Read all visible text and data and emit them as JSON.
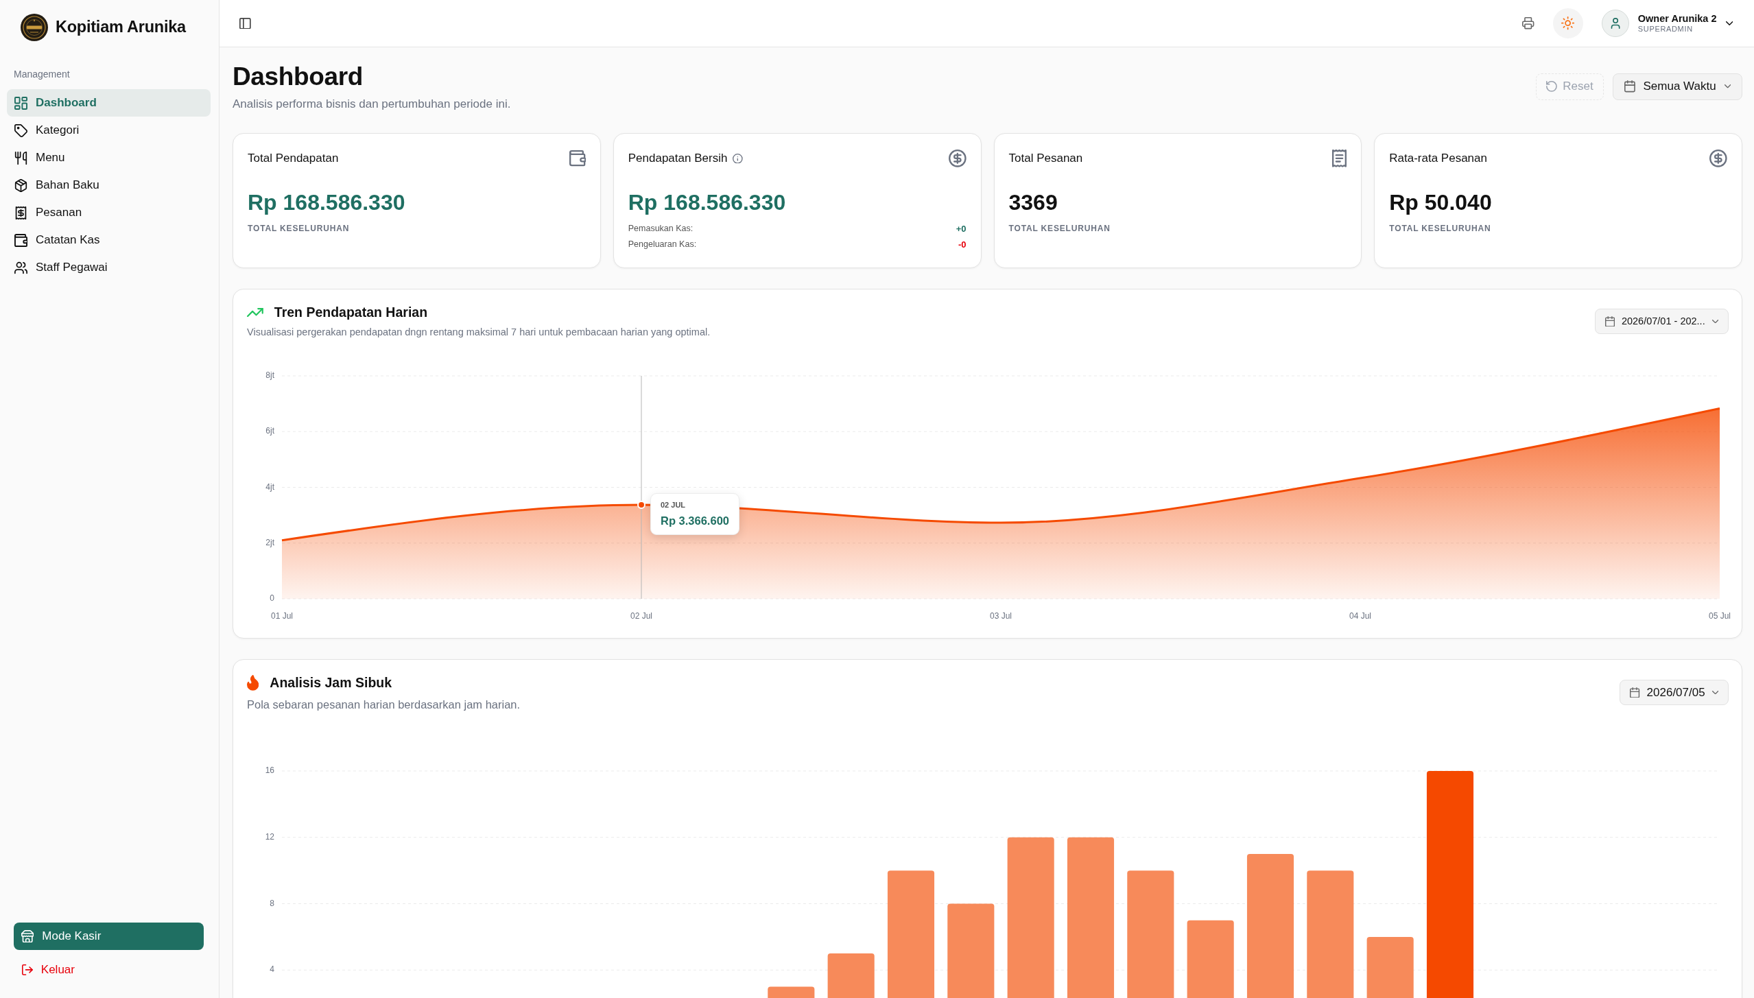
{
  "sidebar": {
    "brand": "Kopitiam Arunika",
    "section": "Management",
    "items": [
      {
        "label": "Dashboard",
        "selected": true
      },
      {
        "label": "Kategori",
        "selected": false
      },
      {
        "label": "Menu",
        "selected": false
      },
      {
        "label": "Bahan Baku",
        "selected": false
      },
      {
        "label": "Pesanan",
        "selected": false
      },
      {
        "label": "Catatan Kas",
        "selected": false
      },
      {
        "label": "Staff Pegawai",
        "selected": false
      }
    ],
    "cashier_button": "Mode Kasir",
    "logout": "Keluar"
  },
  "topbar": {
    "user": {
      "name": "Owner Arunika 2",
      "role": "SUPERADMIN"
    }
  },
  "header": {
    "title": "Dashboard",
    "subtitle": "Analisis performa bisnis dan pertumbuhan periode ini.",
    "reset_button": {
      "label": "Reset",
      "disabled": true
    },
    "period_button": "Semua Waktu"
  },
  "stats": [
    {
      "title": "Total Pendapatan",
      "has_info": false,
      "value": "Rp 168.586.330",
      "accent": true,
      "caption": "TOTAL KESELURUHAN"
    },
    {
      "title": "Pendapatan Bersih",
      "has_info": true,
      "value": "Rp 168.586.330",
      "accent": true,
      "breakdown": [
        {
          "label": "Pemasukan Kas:",
          "value": "+0",
          "color": "#1f6f62"
        },
        {
          "label": "Pengeluaran Kas:",
          "value": "-0",
          "color": "#e7000b"
        }
      ]
    },
    {
      "title": "Total Pesanan",
      "has_info": false,
      "value": "3369",
      "accent": false,
      "caption": "TOTAL KESELURUHAN"
    },
    {
      "title": "Rata-rata Pesanan",
      "has_info": false,
      "value": "Rp 50.040",
      "accent": false,
      "caption": "TOTAL KESELURUHAN"
    }
  ],
  "revenue_trend": {
    "title": "Tren Pendapatan Harian",
    "subtitle": "Visualisasi pergerakan pendapatan dngn rentang maksimal 7 hari untuk pembacaan harian yang optimal.",
    "date_range": "2026/07/01 - 202...",
    "tooltip": {
      "date": "02 JUL",
      "value": "Rp 3.366.600"
    },
    "chart_data": {
      "type": "area",
      "categories": [
        "01 Jul",
        "02 Jul",
        "03 Jul",
        "04 Jul",
        "05 Jul"
      ],
      "series": [
        {
          "color": "#f54a00",
          "values": [
            2.1,
            3.37,
            2.73,
            4.33,
            6.83
          ]
        }
      ],
      "ylim": [
        0,
        8
      ],
      "yticks": [
        {
          "value": 0,
          "label": "0"
        },
        {
          "value": 2,
          "label": "2jt"
        },
        {
          "value": 4,
          "label": "4jt"
        },
        {
          "value": 6,
          "label": "6jt"
        },
        {
          "value": 8,
          "label": "8jt"
        }
      ],
      "grid": true,
      "ref_lines": [
        {
          "axis": "x",
          "value": "02 Jul"
        }
      ],
      "annotations": [
        {
          "x": "02 Jul"
        }
      ]
    }
  },
  "peak_hours": {
    "title": "Analisis Jam Sibuk",
    "subtitle": "Pola sebaran pesanan harian berdasarkan jam harian.",
    "date": "2026/07/05",
    "chart_data": {
      "type": "bar",
      "stacked": true,
      "series": [
        {
          "color": "#f78a5a",
          "values": [
            0,
            0,
            0,
            0,
            0,
            0,
            0,
            0,
            3,
            5,
            10,
            8,
            12,
            12,
            10,
            7,
            11,
            10,
            6,
            0,
            0,
            0,
            0,
            0
          ]
        },
        {
          "color": "#f54900",
          "values": [
            0,
            0,
            0,
            0,
            0,
            0,
            0,
            0,
            0,
            0,
            0,
            0,
            0,
            0,
            0,
            0,
            0,
            0,
            0,
            16,
            0,
            0,
            0,
            0
          ]
        }
      ],
      "ylim": [
        0,
        16
      ],
      "yticks": [
        4,
        8,
        12,
        16
      ],
      "grid": true
    }
  }
}
